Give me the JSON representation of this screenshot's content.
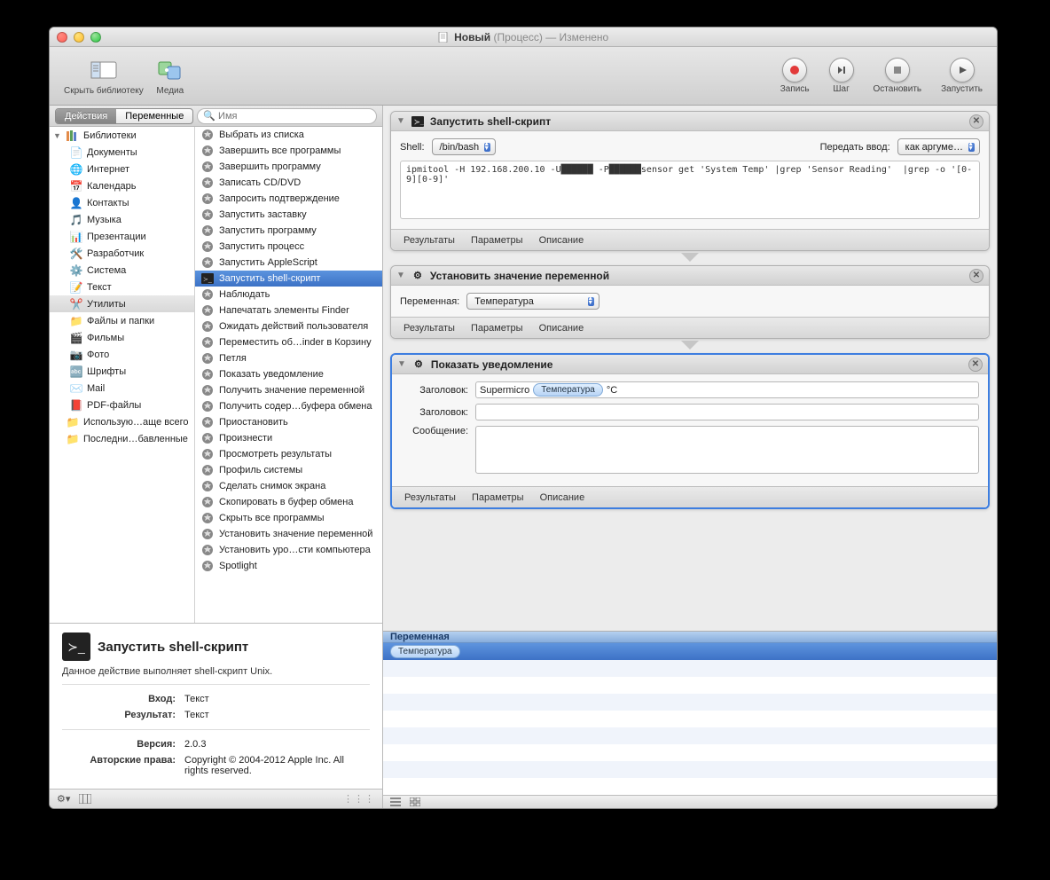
{
  "window": {
    "title_doc": "Новый",
    "title_paren": "(Процесс)",
    "title_state": "— Изменено"
  },
  "toolbar": {
    "hide_library": "Скрыть библиотеку",
    "media": "Медиа",
    "record": "Запись",
    "step": "Шаг",
    "stop": "Остановить",
    "run": "Запустить"
  },
  "lib": {
    "tab_actions": "Действия",
    "tab_vars": "Переменные",
    "search_placeholder": "Имя"
  },
  "tree": {
    "root": "Библиотеки",
    "items": [
      "Документы",
      "Интернет",
      "Календарь",
      "Контакты",
      "Музыка",
      "Презентации",
      "Разработчик",
      "Система",
      "Текст",
      "Утилиты",
      "Файлы и папки",
      "Фильмы",
      "Фото",
      "Шрифты",
      "Mail",
      "PDF-файлы"
    ],
    "bottom": [
      "Использую…аще всего",
      "Последни…бавленные"
    ],
    "selected_index": 9
  },
  "actions_list": [
    "Выбрать из списка",
    "Завершить все программы",
    "Завершить программу",
    "Записать CD/DVD",
    "Запросить подтверждение",
    "Запустить заставку",
    "Запустить программу",
    "Запустить процесс",
    "Запустить AppleScript",
    "Запустить shell-скрипт",
    "Наблюдать",
    "Напечатать элементы Finder",
    "Ожидать действий пользователя",
    "Переместить об…inder в Корзину",
    "Петля",
    "Показать уведомление",
    "Получить значение переменной",
    "Получить содер…буфера обмена",
    "Приостановить",
    "Произнести",
    "Просмотреть результаты",
    "Профиль системы",
    "Сделать снимок экрана",
    "Скопировать в буфер обмена",
    "Скрыть все программы",
    "Установить значение переменной",
    "Установить уро…сти компьютера",
    "Spotlight"
  ],
  "actions_selected_index": 9,
  "info": {
    "title": "Запустить shell-скрипт",
    "desc": "Данное действие выполняет shell-скрипт Unix.",
    "input_label": "Вход:",
    "input_value": "Текст",
    "result_label": "Результат:",
    "result_value": "Текст",
    "version_label": "Версия:",
    "version_value": "2.0.3",
    "copyright_label": "Авторские права:",
    "copyright_value": "Copyright © 2004-2012 Apple Inc.  All rights reserved."
  },
  "card_tabs": {
    "results": "Результаты",
    "params": "Параметры",
    "desc": "Описание"
  },
  "shell": {
    "title": "Запустить shell-скрипт",
    "shell_label": "Shell:",
    "shell_value": "/bin/bash",
    "pass_label": "Передать ввод:",
    "pass_value": "как аргуме…",
    "script": "ipmitool -H 192.168.200.10 -U██████ -P██████sensor get 'System Temp' |grep 'Sensor Reading'  |grep -o '[0-9][0-9]'"
  },
  "setvar": {
    "title": "Установить значение переменной",
    "label": "Переменная:",
    "value": "Температура"
  },
  "notify": {
    "title": "Показать уведомление",
    "header_label": "Заголовок:",
    "header_prefix": "Supermicro",
    "header_var": "Температура",
    "header_suffix": "°C",
    "header2_label": "Заголовок:",
    "message_label": "Сообщение:"
  },
  "varpane": {
    "header": "Переменная",
    "var": "Температура"
  }
}
